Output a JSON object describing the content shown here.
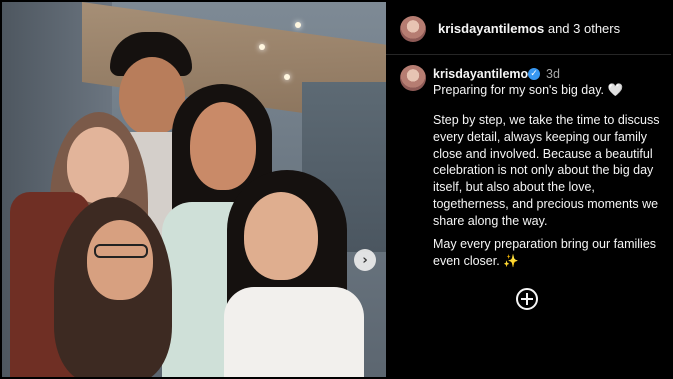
{
  "header": {
    "username": "krisdayantilemos",
    "others_text": "and 3 others"
  },
  "post": {
    "username": "krisdayantilemos",
    "verified": true,
    "time": "3d",
    "caption_line1": "Preparing for my son's big day.",
    "paragraph2": "Step by step, we take the time to discuss every detail, always keeping our family close and involved. Because a beautiful celebration is not only about the big day itself, but also about the love, togetherness, and precious moments we share along the way.",
    "paragraph3": "May every preparation bring our  families even closer."
  },
  "icons": {
    "heart": "white-heart-emoji",
    "sparkle": "sparkles-emoji",
    "next": "chevron-right-icon",
    "add": "plus-circle-icon",
    "verified": "verified-badge-icon"
  },
  "colors": {
    "background": "#000000",
    "text": "#f5f5f5",
    "muted": "#a8a8a8",
    "verified": "#3897f0"
  }
}
